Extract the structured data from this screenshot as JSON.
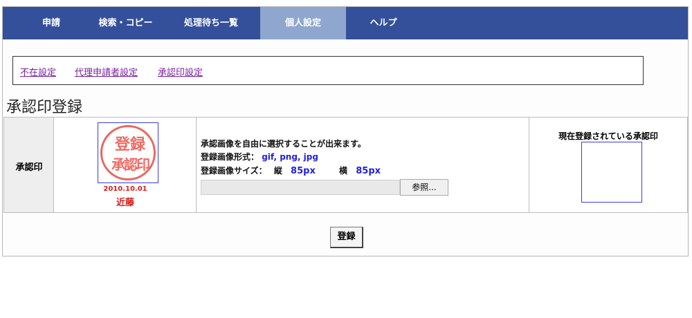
{
  "nav": {
    "items": [
      {
        "label": "申請"
      },
      {
        "label": "検索・コピー"
      },
      {
        "label": "処理待ち一覧"
      },
      {
        "label": "個人設定",
        "active": true
      },
      {
        "label": "ヘルプ"
      }
    ]
  },
  "subnav": {
    "links": [
      {
        "label": "不在設定"
      },
      {
        "label": "代理申請者設定"
      },
      {
        "label": "承認印設定"
      }
    ]
  },
  "page": {
    "title": "承認印登録"
  },
  "form": {
    "row_label": "承認印",
    "stamp": {
      "line1": "登録",
      "line2": "承認印",
      "date": "2010.10.01",
      "name": "近藤"
    },
    "info": {
      "description": "承認画像を自由に選択することが出来ます。",
      "format_label": "登録画像形式：",
      "format_value": "gif, png, jpg",
      "size_label": "登録画像サイズ：",
      "height_label": "縦",
      "height_value": "85px",
      "width_label": "横",
      "width_value": "85px",
      "browse_label": "参照..."
    },
    "current": {
      "title": "現在登録されている承認印"
    },
    "submit_label": "登録"
  },
  "colors": {
    "nav_bg": "#34509a",
    "nav_active_bg": "#8fa7cf",
    "link": "#7a1fa0",
    "value_blue": "#2222dd",
    "stamp_red": "#ef6a62"
  }
}
